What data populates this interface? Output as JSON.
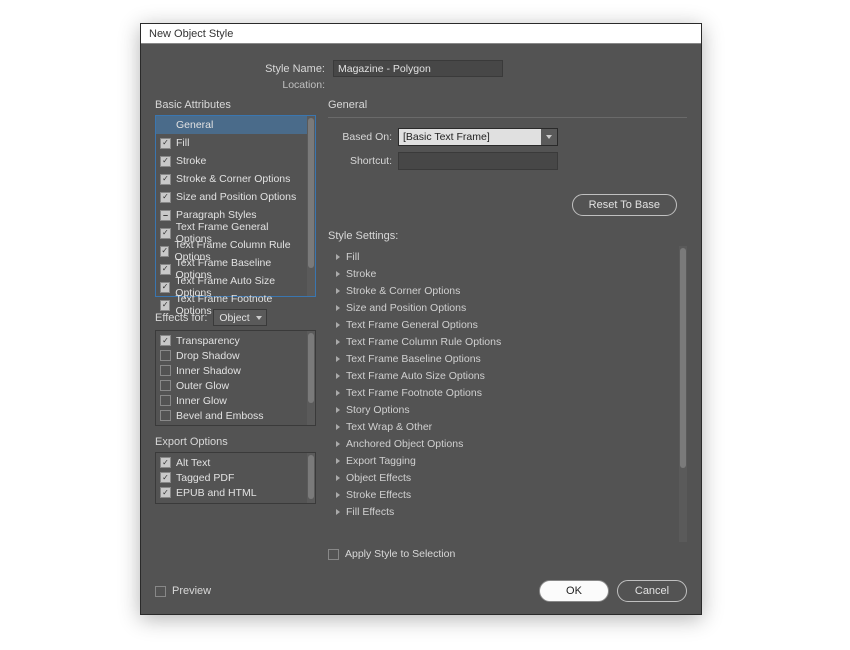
{
  "dialog": {
    "title": "New Object Style",
    "style_name_label": "Style Name:",
    "style_name_value": "Magazine - Polygon",
    "location_label": "Location:"
  },
  "left": {
    "basic_attributes_title": "Basic Attributes",
    "attributes": [
      {
        "label": "General",
        "checked": true,
        "selected": true,
        "nocheck": true
      },
      {
        "label": "Fill",
        "checked": true
      },
      {
        "label": "Stroke",
        "checked": true
      },
      {
        "label": "Stroke & Corner Options",
        "checked": true
      },
      {
        "label": "Size and Position Options",
        "checked": true
      },
      {
        "label": "Paragraph Styles",
        "checked": false,
        "dash": true
      },
      {
        "label": "Text Frame General Options",
        "checked": true
      },
      {
        "label": "Text Frame Column Rule Options",
        "checked": true
      },
      {
        "label": "Text Frame Baseline Options",
        "checked": true
      },
      {
        "label": "Text Frame Auto Size Options",
        "checked": true
      },
      {
        "label": "Text Frame Footnote Options",
        "checked": true
      }
    ],
    "effects_for_label": "Effects for:",
    "effects_for_value": "Object",
    "effects": [
      {
        "label": "Transparency",
        "checked": true
      },
      {
        "label": "Drop Shadow",
        "checked": false
      },
      {
        "label": "Inner Shadow",
        "checked": false
      },
      {
        "label": "Outer Glow",
        "checked": false
      },
      {
        "label": "Inner Glow",
        "checked": false
      },
      {
        "label": "Bevel and Emboss",
        "checked": false
      }
    ],
    "export_title": "Export Options",
    "export_items": [
      {
        "label": "Alt Text",
        "checked": true
      },
      {
        "label": "Tagged PDF",
        "checked": true
      },
      {
        "label": "EPUB and HTML",
        "checked": true
      }
    ]
  },
  "right": {
    "general_title": "General",
    "based_on_label": "Based On:",
    "based_on_value": "[Basic Text Frame]",
    "shortcut_label": "Shortcut:",
    "reset_label": "Reset To Base",
    "settings_title": "Style Settings:",
    "settings_tree": [
      "Fill",
      "Stroke",
      "Stroke & Corner Options",
      "Size and Position Options",
      "Text Frame General Options",
      "Text Frame Column Rule Options",
      "Text Frame Baseline Options",
      "Text Frame Auto Size Options",
      "Text Frame Footnote Options",
      "Story Options",
      "Text Wrap & Other",
      "Anchored Object Options",
      "Export Tagging",
      "Object Effects",
      "Stroke Effects",
      "Fill Effects"
    ],
    "apply_label": "Apply Style to Selection"
  },
  "footer": {
    "preview_label": "Preview",
    "ok_label": "OK",
    "cancel_label": "Cancel"
  }
}
